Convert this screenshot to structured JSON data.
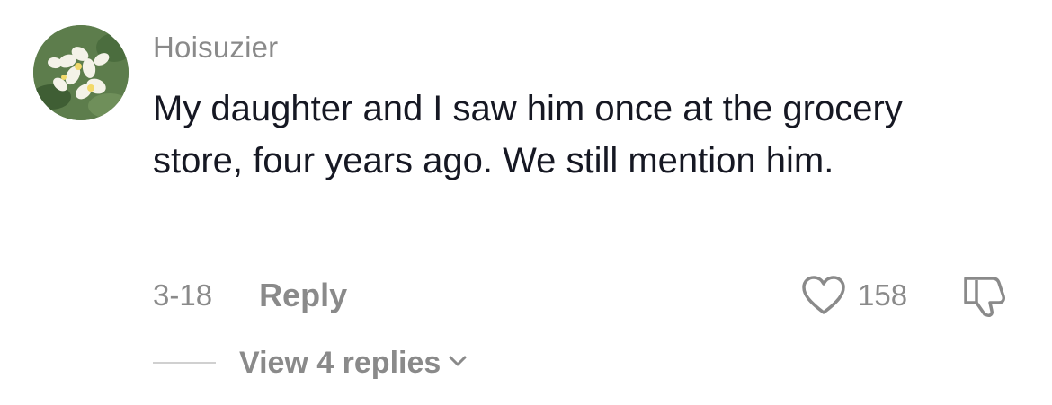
{
  "comment": {
    "username": "Hoisuzier",
    "text": "My daughter and I saw him once at the grocery store, four years ago. We still mention him.",
    "date": "3-18",
    "reply_label": "Reply",
    "like_count": "158",
    "view_replies_label": "View 4 replies",
    "avatar_icon": "flower-avatar",
    "like_icon": "heart-outline-icon",
    "dislike_icon": "thumbs-down-icon",
    "chevron_icon": "chevron-down-icon"
  },
  "colors": {
    "primary_text": "#161823",
    "secondary_text": "#8a8a8a",
    "divider": "#d0d0d0",
    "background": "#ffffff"
  }
}
